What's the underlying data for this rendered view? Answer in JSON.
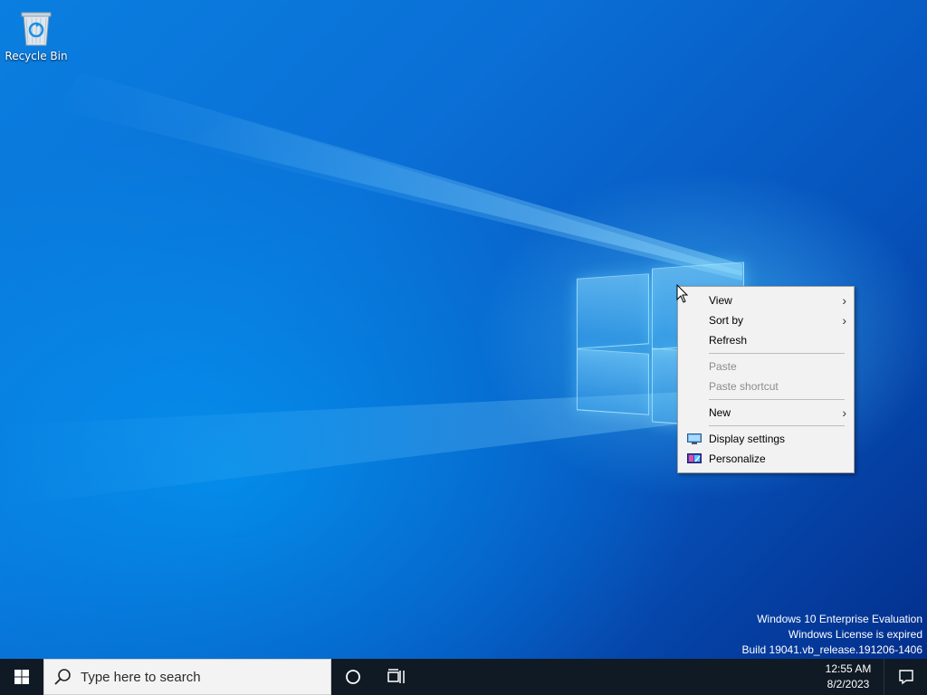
{
  "desktop": {
    "icons": [
      {
        "label": "Recycle Bin",
        "icon": "recycle-bin-icon"
      }
    ],
    "watermark": {
      "line1": "Windows 10 Enterprise Evaluation",
      "line2": "Windows License is expired",
      "line3": "Build 19041.vb_release.191206-1406"
    }
  },
  "context_menu": {
    "items": [
      {
        "label": "View",
        "submenu": true,
        "enabled": true
      },
      {
        "label": "Sort by",
        "submenu": true,
        "enabled": true
      },
      {
        "label": "Refresh",
        "submenu": false,
        "enabled": true
      },
      {
        "label": "Paste",
        "submenu": false,
        "enabled": false
      },
      {
        "label": "Paste shortcut",
        "submenu": false,
        "enabled": false
      },
      {
        "label": "New",
        "submenu": true,
        "enabled": true
      },
      {
        "label": "Display settings",
        "submenu": false,
        "enabled": true,
        "icon": "display-icon"
      },
      {
        "label": "Personalize",
        "submenu": false,
        "enabled": true,
        "icon": "personalize-icon"
      }
    ],
    "submenu_arrow": ">"
  },
  "taskbar": {
    "start_icon": "windows-logo-icon",
    "search": {
      "placeholder": "Type here to search",
      "value": ""
    },
    "cortana_icon": "cortana-icon",
    "task_view_icon": "task-view-icon",
    "clock": {
      "time": "12:55 AM",
      "date": "8/2/2023"
    },
    "notification_icon": "notification-icon"
  },
  "colors": {
    "taskbar": "#101a24",
    "menu_bg": "#f2f2f2",
    "desktop_blue": "#0a6fd6"
  }
}
